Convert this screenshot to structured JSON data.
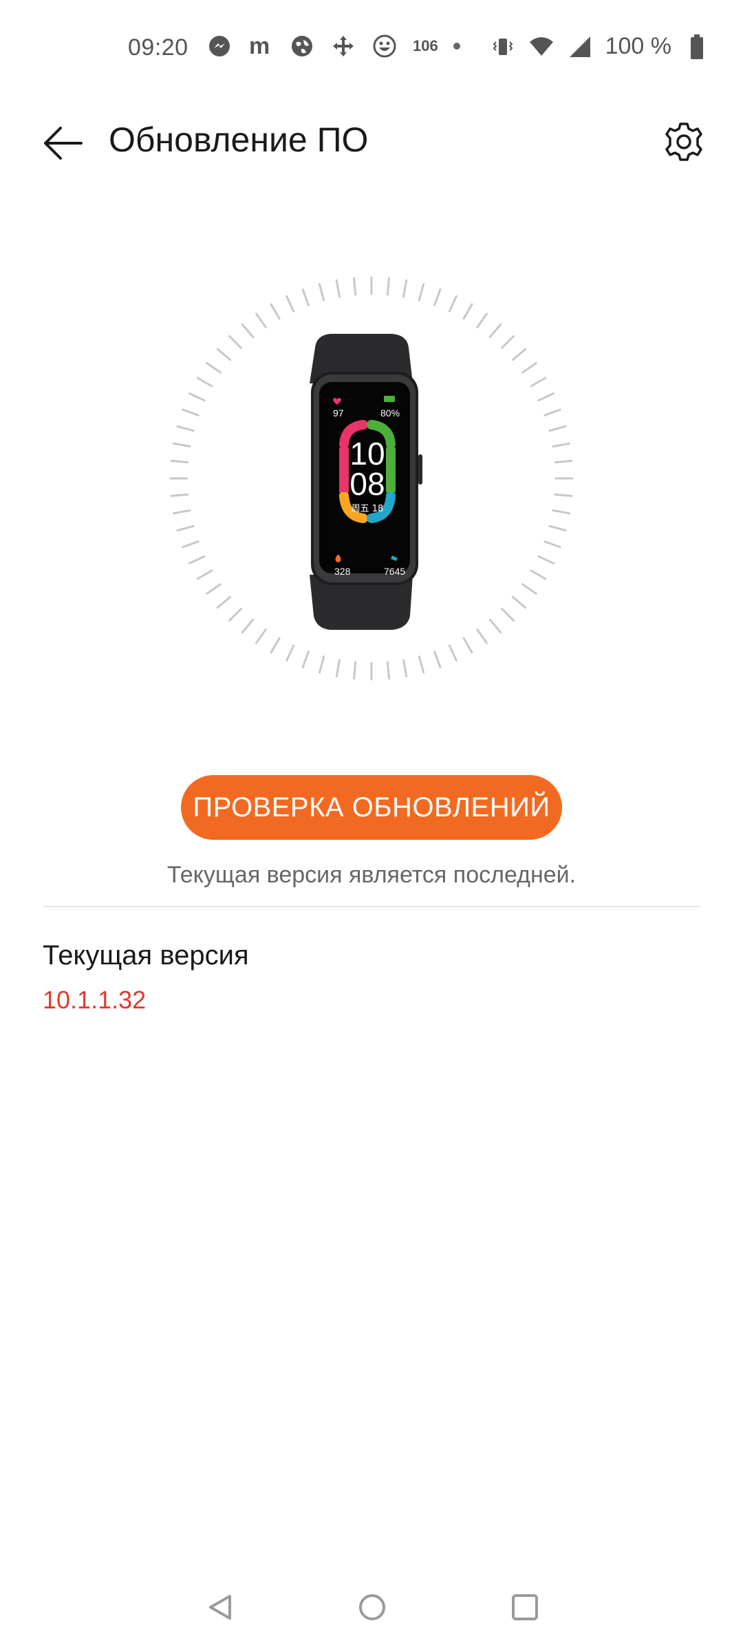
{
  "status_bar": {
    "time": "09:20",
    "notification_count": "106",
    "battery_text": "100 %",
    "icons": [
      "messenger-icon",
      "m-icon",
      "globe-icon",
      "move-icon",
      "emoji-icon",
      "vibrate-icon",
      "wifi-icon",
      "signal-icon",
      "battery-icon"
    ]
  },
  "header": {
    "title": "Обновление ПО"
  },
  "device": {
    "heart_rate": "97",
    "battery": "80%",
    "time_hour": "10",
    "time_minute": "08",
    "date": "周五 18",
    "calories": "328",
    "steps": "7645"
  },
  "update": {
    "check_button_label": "ПРОВЕРКА ОБНОВЛЕНИЙ",
    "status_message": "Текущая версия является последней."
  },
  "version": {
    "label": "Текущая версия",
    "value": "10.1.1.32"
  },
  "colors": {
    "accent": "#f26a21",
    "version_red": "#e03a2f"
  }
}
